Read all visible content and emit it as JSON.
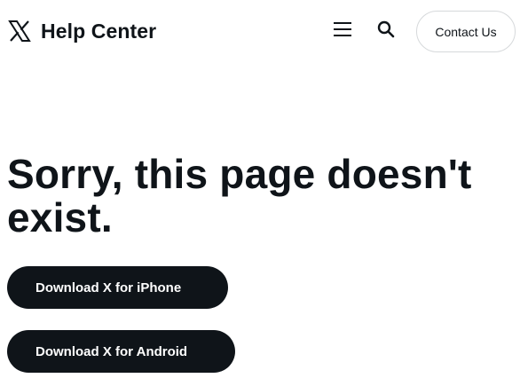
{
  "header": {
    "logo_icon": "x-logo-icon",
    "title": "Help Center",
    "menu_icon": "hamburger-menu-icon",
    "search_icon": "search-icon",
    "contact_label": "Contact Us"
  },
  "main": {
    "headline": "Sorry, this page doesn't exist.",
    "buttons": [
      {
        "label": "Download X for iPhone"
      },
      {
        "label": "Download X for Android"
      }
    ]
  },
  "colors": {
    "text": "#0f1419",
    "button_bg": "#0f1419",
    "button_text": "#ffffff",
    "border": "#d6d9db",
    "background": "#ffffff"
  }
}
